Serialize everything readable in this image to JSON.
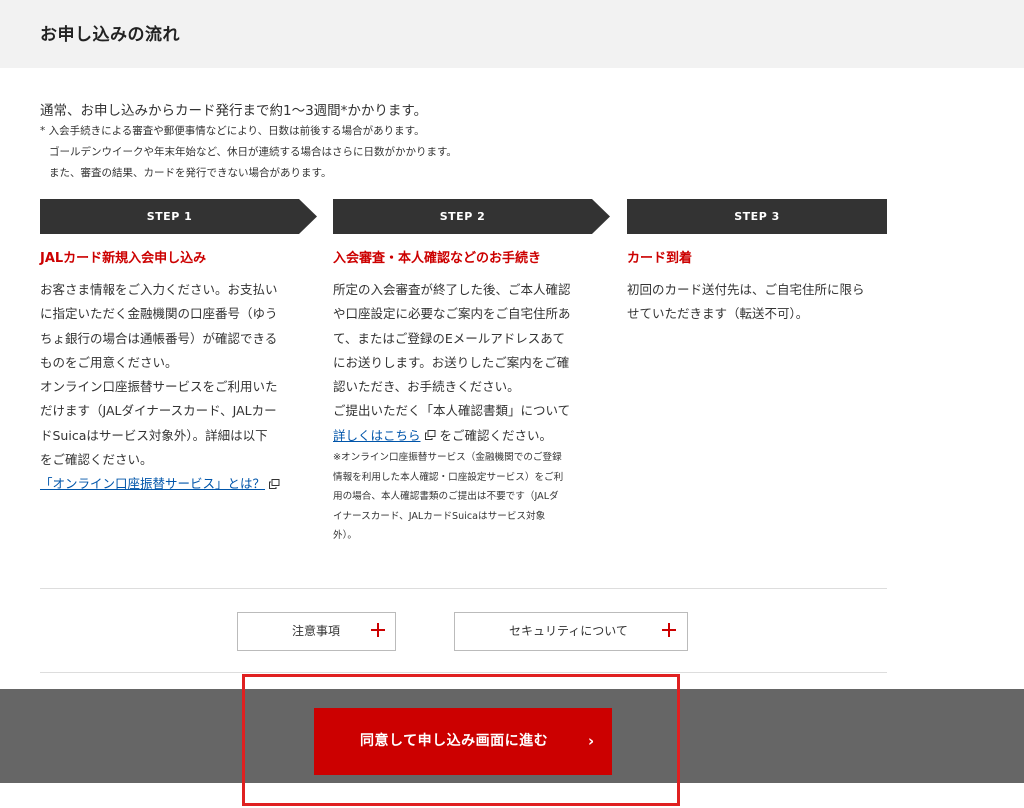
{
  "header": {
    "title": "お申し込みの流れ"
  },
  "intro": {
    "main": "通常、お申し込みからカード発行まで約1〜3週間*かかります。",
    "notes": [
      "* 入会手続きによる審査や郵便事情などにより、日数は前後する場合があります。",
      "ゴールデンウイークや年末年始など、休日が連続する場合はさらに日数がかかります。",
      "また、審査の結果、カードを発行できない場合があります。"
    ]
  },
  "steps": [
    {
      "label": "STEP 1",
      "title": "JALカード新規入会申し込み",
      "lines": [
        "お客さま情報をご入力ください。お支払い",
        "に指定いただく金融機関の口座番号（ゆう",
        "ちょ銀行の場合は通帳番号）が確認できる",
        "ものをご用意ください。",
        "オンライン口座振替サービスをご利用いた",
        "だけます（JALダイナースカード、JALカー",
        "ドSuicaはサービス対象外）。詳細は以下",
        "をご確認ください。"
      ],
      "link": "「オンライン口座振替サービス」とは？"
    },
    {
      "label": "STEP 2",
      "title": "入会審査・本人確認などのお手続き",
      "lines": [
        "所定の入会審査が終了した後、ご本人確認",
        "や口座設定に必要なご案内をご自宅住所あ",
        "て、またはご登録のEメールアドレスあて",
        "にお送りします。お送りしたご案内をご確",
        "認いただき、お手続きください。",
        "ご提出いただく「本人確認書類」について"
      ],
      "link": "詳しくはこちら",
      "link_suffix": "をご確認ください。",
      "note_lines": [
        "※オンライン口座振替サービス（金融機関でのご登録",
        "情報を利用した本人確認・口座設定サービス）をご利",
        "用の場合、本人確認書類のご提出は不要です（JALダ",
        "イナースカード、JALカードSuicaはサービス対象",
        "外）。"
      ]
    },
    {
      "label": "STEP 3",
      "title": "カード到着",
      "lines": [
        "初回のカード送付先は、ご自宅住所に限ら",
        "せていただきます（転送不可）。"
      ]
    }
  ],
  "accordions": {
    "notes_label": "注意事項",
    "security_label": "セキュリティについて"
  },
  "cta": {
    "label": "同意して申し込み画面に進む",
    "chevron": "›"
  },
  "colors": {
    "accent": "#cc0000",
    "step_bar": "#333333",
    "footer": "#666666",
    "link": "#0055aa",
    "highlight": "#e02020"
  },
  "icons": {
    "external_link": "external-link-icon",
    "plus": "plus-icon",
    "chevron": "chevron-right-icon"
  }
}
